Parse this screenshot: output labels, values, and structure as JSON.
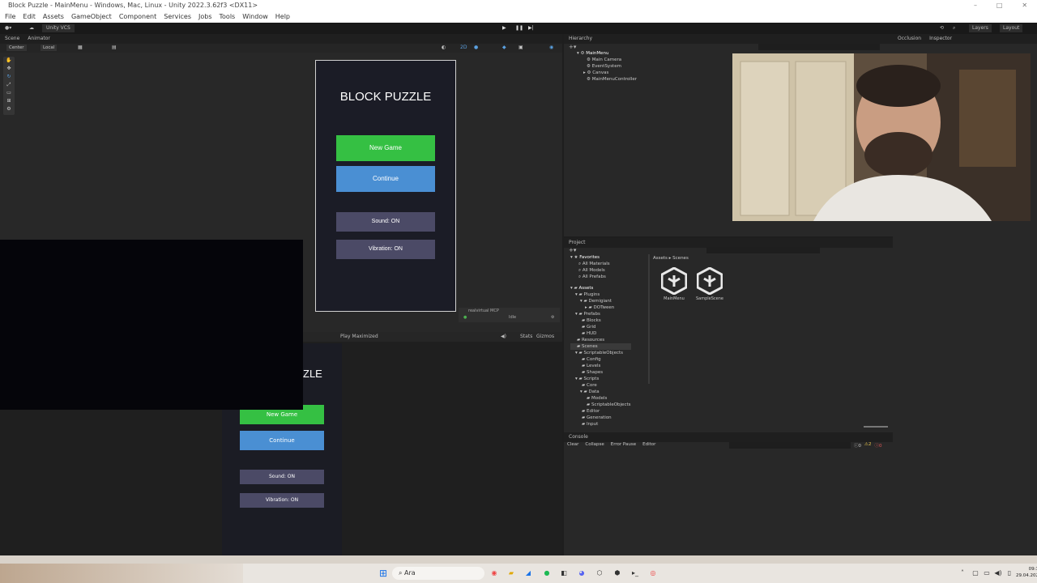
{
  "window": {
    "title": "Block Puzzle - MainMenu - Windows, Mac, Linux - Unity 2022.3.62f3 <DX11>"
  },
  "menu": [
    "File",
    "Edit",
    "Assets",
    "GameObject",
    "Component",
    "Services",
    "Jobs",
    "Tools",
    "Window",
    "Help"
  ],
  "toolbar": {
    "vcs": "Unity VCS",
    "layers": "Layers",
    "layout": "Layout"
  },
  "scene": {
    "tabs": [
      "Scene",
      "Animator"
    ],
    "pivot": "Center",
    "space": "Local",
    "mcp_label": "realvirtual MCP",
    "mcp_status": "Idle"
  },
  "menu_ui": {
    "title": "BLOCK PUZZLE",
    "buttons": [
      "New Game",
      "Continue",
      "Sound: ON",
      "Vibration: ON"
    ],
    "colors": {
      "green": "#35c043",
      "blue": "#4a8fd3",
      "slate": "#4b4a66"
    }
  },
  "game": {
    "play_mode": "Play Maximized",
    "stats": "Stats",
    "gizmos": "Gizmos",
    "title_fragment": "ZLE"
  },
  "hierarchy": {
    "tabs": [
      "Hierarchy"
    ],
    "items": [
      "MainMenu",
      "Main Camera",
      "EventSystem",
      "Canvas",
      "MainMenuController"
    ]
  },
  "inspector": {
    "tabs": [
      "Occlusion",
      "Inspector"
    ]
  },
  "project": {
    "tab": "Project",
    "favorites_label": "Favorites",
    "favorites": [
      "All Materials",
      "All Models",
      "All Prefabs"
    ],
    "tree": [
      "Assets",
      "Plugins",
      "Demigiant",
      "DOTween",
      "Prefabs",
      "Blocks",
      "Grid",
      "HUD",
      "Resources",
      "Scenes",
      "ScriptableObjects",
      "Config",
      "Levels",
      "Shapes",
      "Scripts",
      "Core",
      "Data",
      "Models",
      "ScriptableObjects",
      "Editor",
      "Generation",
      "Input"
    ],
    "breadcrumb": [
      "Assets",
      "Scenes"
    ],
    "files": [
      "MainMenu",
      "SampleScene"
    ]
  },
  "console": {
    "tab": "Console",
    "buttons": [
      "Clear",
      "Collapse",
      "Error Pause",
      "Editor"
    ],
    "counts": [
      "0",
      "2",
      "0"
    ]
  },
  "taskbar": {
    "search": "Ara",
    "time": "09:38",
    "date": "29.04.2026"
  }
}
